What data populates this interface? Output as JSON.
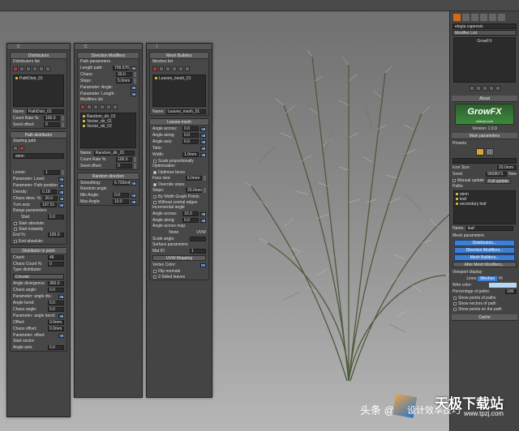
{
  "dist_panel": {
    "title": "Distributors",
    "list_label": "Distributors list",
    "items": [
      "PathDistr_01"
    ],
    "name_label": "Name:",
    "name": "PathDistr_01",
    "count_rate_label": "Count Rate %:",
    "count_rate": "100.0",
    "seed_label": "Seed offset:",
    "seed": "0",
    "path_title": "Path distributor",
    "starting_path": "Starting path",
    "path_item": "stem",
    "levels_label": "Levels:",
    "levels": "1",
    "param_level": "Parameter: Level:",
    "param_pos": "Parameter: Path position",
    "density_label": "Density:",
    "density": "0.18",
    "chaos_dens_label": "Chaos dens. %:",
    "chaos_dens": "20.0",
    "turn_label": "Turn axis:",
    "turn": "137.51",
    "range_title": "Range parameters",
    "start_label": "Start",
    "start": "0.0",
    "start_abs": "Start absolute:",
    "start_inst": "Start instantly",
    "end_label": "End %:",
    "end": "100.0",
    "end_abs": "End absolute:",
    "inpoint_title": "Distributor in point",
    "count_label": "Count:",
    "count": "46",
    "chaos_count_label": "Chaos Count %:",
    "chaos_count": "0",
    "type_label": "Type distributor:",
    "type": "Circular",
    "ang_div_label": "Angle divergence:",
    "ang_div": "360.0",
    "chaos_angle_label": "Chaos angle:",
    "chaos_angle": "0.0",
    "param_angle_div": "Parameter: angle div.:",
    "ang_bend_label": "Angle bend:",
    "ang_bend": "0.0",
    "chaos_angle2_label": "Chaos angle:",
    "chaos_angle2": "0.0",
    "param_angle_bend": "Parameter: angle bend:",
    "offset_label": "Offset:",
    "offset": "0.0mm",
    "chaos_off_label": "Chaos offset:",
    "chaos_off": "0.0mm",
    "param_offset": "Parameter: offset:",
    "start_vec": "Start vector:",
    "ang_axis_label": "Angle axis:",
    "ang_axis": "0.0"
  },
  "dir_panel": {
    "title": "Direction Modifiers",
    "path_params": "Path parameters",
    "len_label": "Length path:",
    "len": "709.576",
    "chaos_label": "Chaos:",
    "chaos": "30.0",
    "steps_label": "Steps:",
    "steps": "5.0mm",
    "param_angle": "Parameter: Angle:",
    "param_length": "Parameter: Length:",
    "mods_list": "Modifiers list",
    "items": [
      "Random_dir_01",
      "Vector_dir_01",
      "Vector_dir_02"
    ],
    "name_label": "Name:",
    "name": "Random_dir_01",
    "count_rate_label": "Count Rate %:",
    "count_rate": "100.0",
    "seed_label": "Seed offset:",
    "seed": "0",
    "rand_title": "Random direction",
    "smooth_label": "Smoothing:",
    "smooth": "6.793mm",
    "rand_angle": "Random angle",
    "min_label": "Min Angle:",
    "min": "0.0",
    "max_label": "Max Angle:",
    "max": "10.0"
  },
  "mesh_panel": {
    "title": "Mesh Builders",
    "list_label": "Meshes list",
    "items": [
      "Leaves_mesh_01"
    ],
    "name_label": "Name:",
    "name": "Leaves_mesh_01",
    "leaves_title": "Leaves mesh",
    "across_label": "Angle across:",
    "across": "0.0",
    "along_label": "Angle along:",
    "along": "0.0",
    "axis_label": "Angle axis:",
    "axis": "0.0",
    "tatio_label": "Tatio:",
    "width_label": "Width:",
    "width": "1.0mm",
    "scale_prop": "Scale proportionally",
    "optimization": "Optimization",
    "opt_faces": "Optimize faces",
    "face_size_label": "Face size:",
    "face_size": "5.0mm",
    "override": "Override steps",
    "steps_label": "Steps:",
    "steps": "20.0mm",
    "by_width": "By Width Graph Points",
    "without_central": "Without central edges",
    "incr_angle": "Incremental angle",
    "across2_label": "Angle across:",
    "across2": "10.0",
    "along2_label": "Angle along:",
    "along2": "0.0",
    "across_map": "Angle across map:",
    "none": "None",
    "uvw": "UVW",
    "scale_angle": "Scale angle:",
    "surface_params": "Surface parameters",
    "mat_label": "Mat ID:",
    "mat": "1",
    "uvw_map": "UVW Mapping",
    "vertex_color": "Vertex Color:",
    "flip": "Flip normals",
    "two_sided": "2-Sided leaves"
  },
  "cmd": {
    "object_name": "elegia capensis",
    "modifier_list": "Modifier List",
    "stack_item": "GrowFX",
    "about": "About",
    "logo": "GrowFX",
    "logo_site": "exlevel.com",
    "version": "Version: 1.9.9",
    "main_params": "Main parameters",
    "presets": "Presets",
    "icon_size_label": "Icon Size:",
    "icon_size": "20.0mm",
    "seed_label": "Seed:",
    "seed": "9658671",
    "new_btn": "New",
    "manual_update": "Manual update",
    "full_update": "Full update",
    "paths_label": "Paths",
    "paths": [
      "stem",
      "leaf",
      "secondary leaf"
    ],
    "name_label": "Name:",
    "name": "leaf",
    "mesh_params": "Mesh parameters",
    "btn_dist": "Distributors...",
    "btn_dir": "Direction Modifiers...",
    "btn_mesh": "Mesh Builders...",
    "btn_after": "After Mesh Modifiers...",
    "viewport_display": "Viewport display",
    "lines": "Lines",
    "meshes": "Meshes",
    "hi": "Hi",
    "wire_color": "Wire color:",
    "percent_paths": "Percentage of paths:",
    "percent": "100",
    "show_points": "Show points of paths",
    "show_vectors": "Show vectors of path",
    "show_points_path": "Show points on the path",
    "cache": "Cache"
  },
  "watermark": {
    "text1": "头条 @",
    "text2": "设计效率技巧",
    "brand": "天极下载站",
    "url": "www.tpzj.com"
  }
}
